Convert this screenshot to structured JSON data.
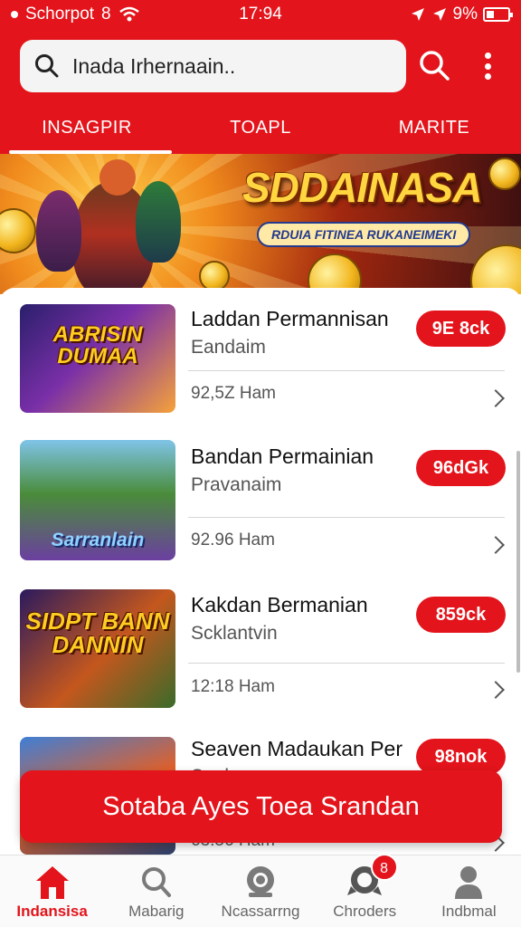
{
  "status_bar": {
    "carrier": "Schorpot",
    "network": "8",
    "time": "17:94",
    "battery": "9%"
  },
  "search": {
    "placeholder": "Inada Irhernaain.."
  },
  "tabs": [
    {
      "label": "INSAGPIR",
      "active": true
    },
    {
      "label": "TOAPL",
      "active": false
    },
    {
      "label": "MARITE",
      "active": false
    }
  ],
  "banner": {
    "title": "SDDAINASA",
    "subtitle": "RDUIA FITINEA RUKANEIMEKI"
  },
  "games": [
    {
      "title": "Laddan Permannisan",
      "subtitle": "Eandaim",
      "meta": "92,5Z Ham",
      "price": "9E 8ck",
      "thumb_label": "ABRISIN DUMAA"
    },
    {
      "title": "Bandan Permainian",
      "subtitle": "Pravanaim",
      "meta": "92.96 Ham",
      "price": "96dGk",
      "thumb_label": "Sarranlain"
    },
    {
      "title": "Kakdan Bermanian",
      "subtitle": "Scklantvin",
      "meta": "12:18 Ham",
      "price": "859ck",
      "thumb_label": "SIDPT BANN DANNIN"
    },
    {
      "title": "Seaven Madaukan Per",
      "subtitle": "Sanlaun",
      "meta": "63.56 Ham",
      "price": "98nok",
      "thumb_label": ""
    }
  ],
  "cta": {
    "label": "Sotaba Ayes Toea Srandan"
  },
  "bottom_nav": [
    {
      "label": "Indansisa",
      "icon": "home-icon",
      "active": true
    },
    {
      "label": "Mabarig",
      "icon": "search-icon",
      "active": false
    },
    {
      "label": "Ncassarrng",
      "icon": "gamepad-icon",
      "active": false
    },
    {
      "label": "Chroders",
      "icon": "controller-icon",
      "active": false,
      "badge": "8"
    },
    {
      "label": "Indbmal",
      "icon": "profile-icon",
      "active": false
    }
  ],
  "colors": {
    "accent": "#e3141b",
    "background": "#ffffff",
    "text": "#111111",
    "muted": "#555555"
  }
}
